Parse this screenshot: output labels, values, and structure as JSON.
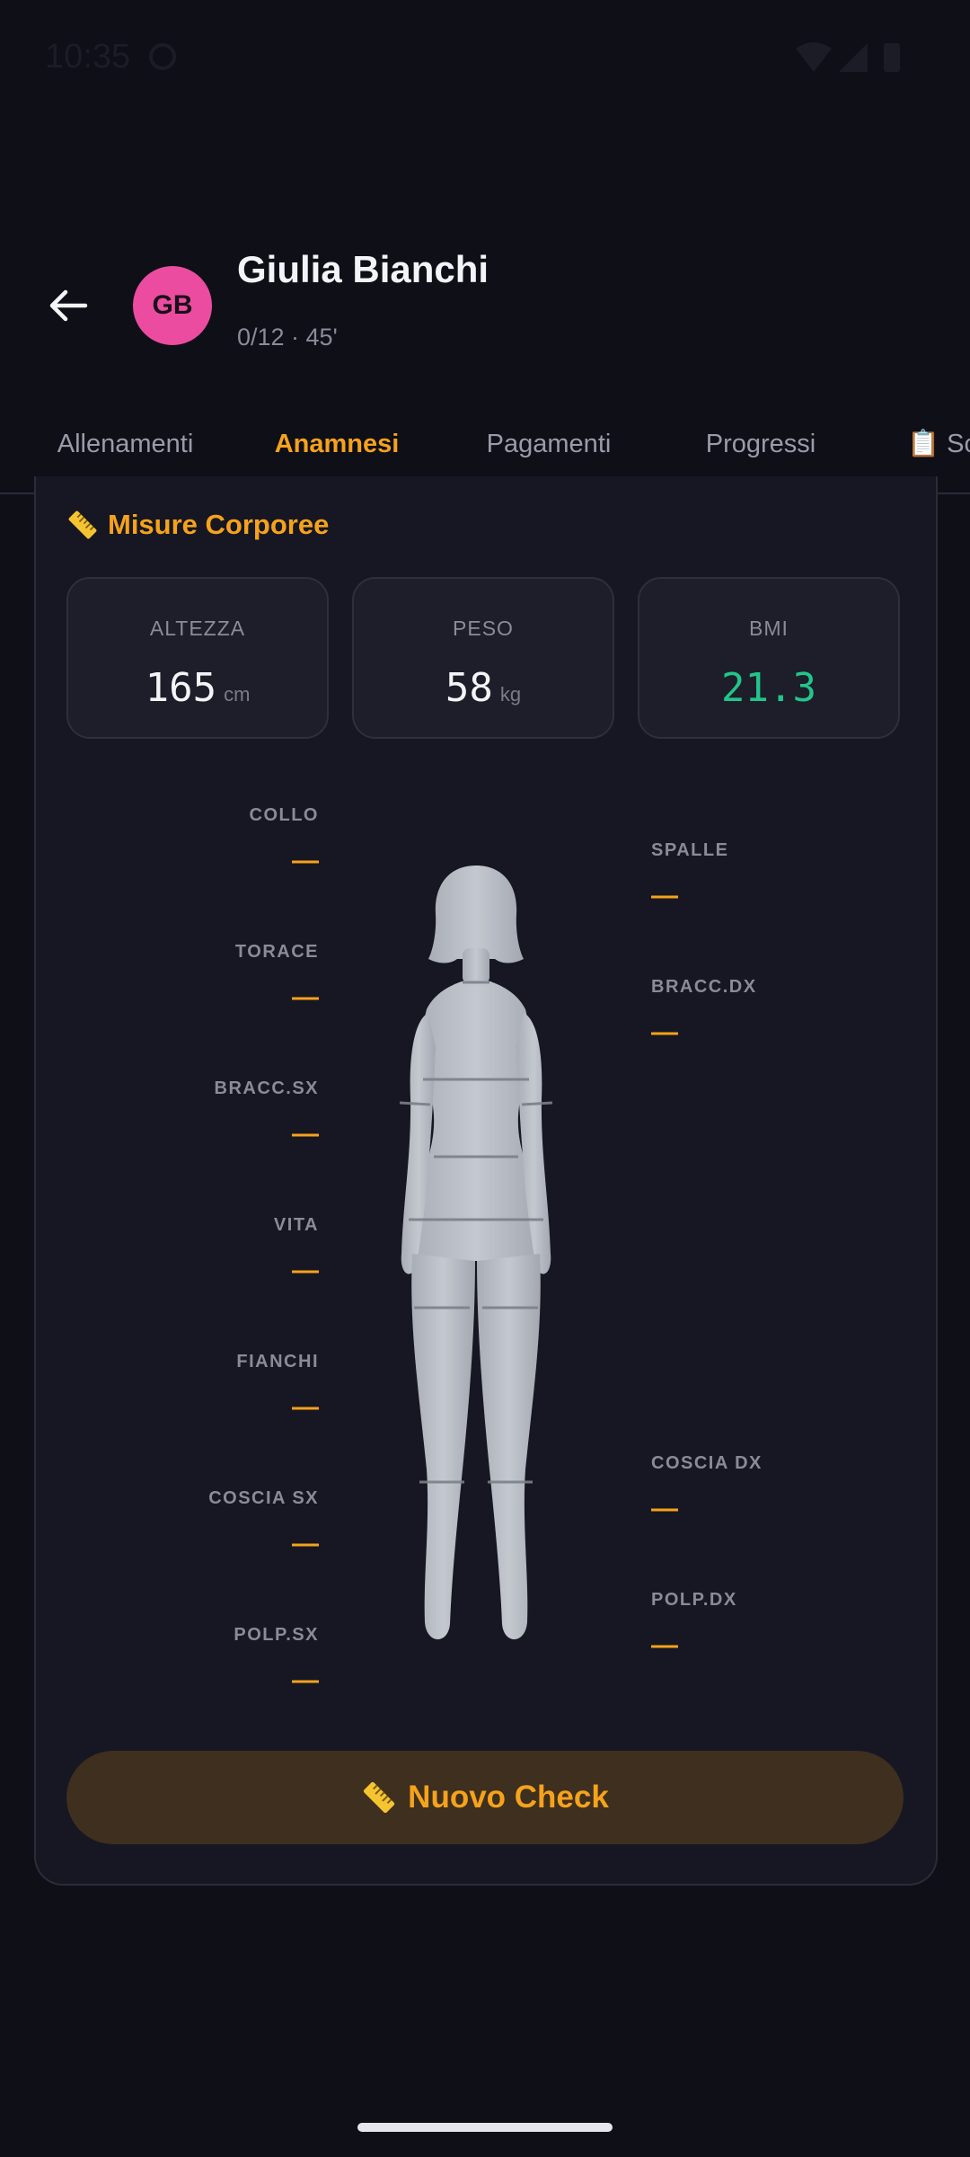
{
  "status_bar": {
    "time": "10:35"
  },
  "header": {
    "avatar_initials": "GB",
    "name": "Giulia Bianchi",
    "subtitle": "0/12 · 45'"
  },
  "tabs": [
    {
      "label": "Allenamenti",
      "active": false
    },
    {
      "label": "Anamnesi",
      "active": true
    },
    {
      "label": "Pagamenti",
      "active": false
    },
    {
      "label": "Progressi",
      "active": false
    },
    {
      "label": "📋 Sc",
      "active": false
    }
  ],
  "section": {
    "icon": "ruler-icon",
    "title": "Misure Corporee"
  },
  "stats": {
    "height": {
      "label": "ALTEZZA",
      "value": "165",
      "unit": "cm"
    },
    "weight": {
      "label": "PESO",
      "value": "58",
      "unit": "kg"
    },
    "bmi": {
      "label": "BMI",
      "value": "21.3",
      "color": "#22c58a"
    }
  },
  "measurements_left": [
    {
      "label": "COLLO",
      "value": "—"
    },
    {
      "label": "TORACE",
      "value": "—"
    },
    {
      "label": "BRACC.SX",
      "value": "—"
    },
    {
      "label": "VITA",
      "value": "—"
    },
    {
      "label": "FIANCHI",
      "value": "—"
    },
    {
      "label": "COSCIA SX",
      "value": "—"
    },
    {
      "label": "POLP.SX",
      "value": "—"
    }
  ],
  "measurements_right": [
    {
      "label": "SPALLE",
      "value": "—"
    },
    {
      "label": "BRACC.DX",
      "value": "—"
    },
    {
      "label": "COSCIA DX",
      "value": "—"
    },
    {
      "label": "POLP.DX",
      "value": "—"
    }
  ],
  "button": {
    "label": "Nuovo Check",
    "icon": "ruler-icon"
  },
  "colors": {
    "accent": "#f5a21c",
    "avatar": "#ec4c9f",
    "background": "#0e0f17"
  }
}
